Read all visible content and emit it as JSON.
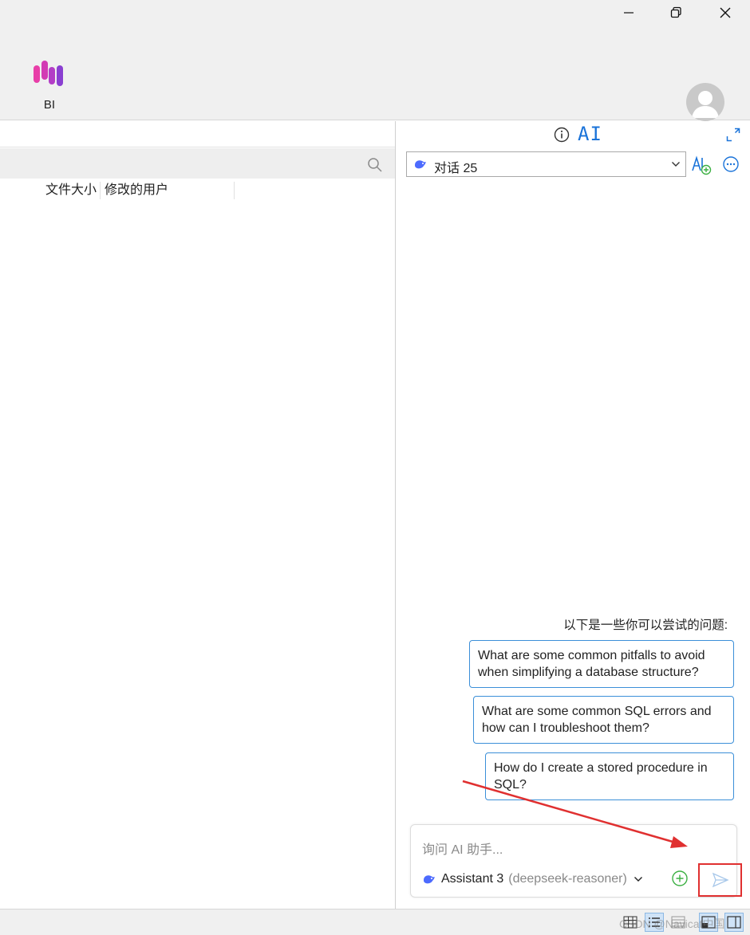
{
  "app": {
    "bi_label": "BI"
  },
  "left_panel": {
    "columns": [
      "文件大小",
      "修改的用户"
    ]
  },
  "ai_panel": {
    "title": "AI",
    "conversation": {
      "selected": "对话 25"
    },
    "suggestions": {
      "heading": "以下是一些你可以尝试的问题:",
      "items": [
        "What are some common pitfalls to avoid when simplifying a database structure?",
        "What are some common SQL errors and how can I troubleshoot them?",
        "How do I create a stored procedure in SQL?"
      ]
    },
    "input": {
      "placeholder": "询问 AI 助手...",
      "value": ""
    },
    "model": {
      "name": "Assistant 3",
      "id": "(deepseek-reasoner)"
    }
  },
  "statusbar": {
    "watermark": "CSDN @Navicat中国"
  },
  "colors": {
    "accent": "#1a73d9",
    "chip_border": "#3b8fd8",
    "annotation": "#e03030",
    "attach_green": "#3cb043",
    "logo_pink": "#e83ea8",
    "logo_purple": "#8a3fd1"
  },
  "icons": {
    "logo": "bi-logo-icon",
    "search": "search-icon",
    "info": "info-icon",
    "expand": "expand-icon",
    "whale": "deepseek-whale-icon",
    "new_chat": "new-ai-chat-icon",
    "more": "more-options-icon",
    "attach": "add-circle-icon",
    "send": "send-icon"
  }
}
